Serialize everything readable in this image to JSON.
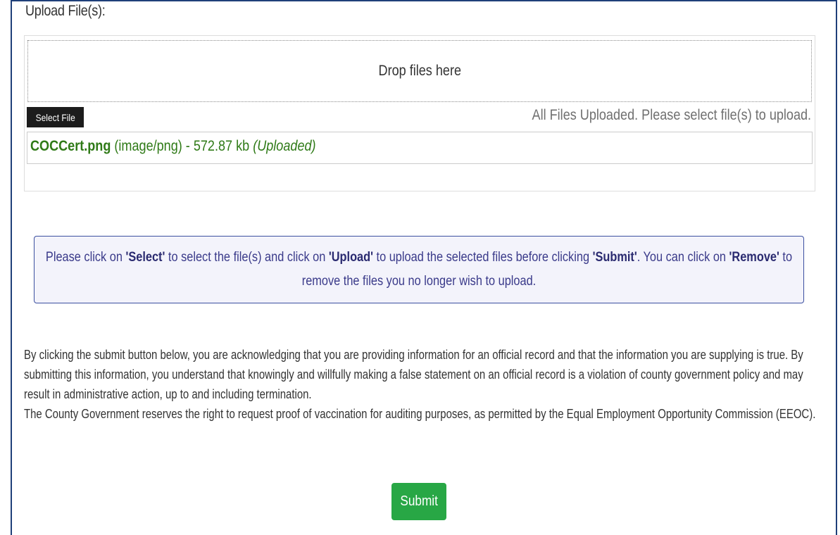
{
  "upload": {
    "label": "Upload File(s):",
    "dropzone_text": "Drop files here",
    "select_button": "Select File",
    "status_message": "All Files Uploaded. Please select file(s) to upload.",
    "files": [
      {
        "name": "COCCert.png",
        "type": "(image/png)",
        "size": "- 572.87 kb",
        "state": "(Uploaded)"
      }
    ]
  },
  "instructions": {
    "part1": "Please click on ",
    "select": "'Select'",
    "part2": " to select the file(s) and click on ",
    "upload": "'Upload'",
    "part3": " to upload the selected files before clicking ",
    "submit": "'Submit'",
    "part4": ". You can click on ",
    "remove": "'Remove'",
    "part5": " to remove the files you no longer wish to upload."
  },
  "disclaimer": {
    "paragraph1": "By clicking the submit button below, you are acknowledging that you are providing information for an official record and that the information you are supplying is true. By submitting this information, you understand that knowingly and willfully making a false statement on an official record is a violation of county government policy and may result in administrative action, up to and including termination.",
    "paragraph2": "The County Government reserves the right to request proof of vaccination for auditing purposes, as permitted by the Equal Employment Opportunity Commission (EEOC)."
  },
  "actions": {
    "submit_label": "Submit"
  },
  "colors": {
    "frame_border": "#1f3f79",
    "file_text": "#2f7a17",
    "info_border": "#3b4fa0",
    "info_bg": "#f3f3fb",
    "submit_bg": "#28a745"
  }
}
